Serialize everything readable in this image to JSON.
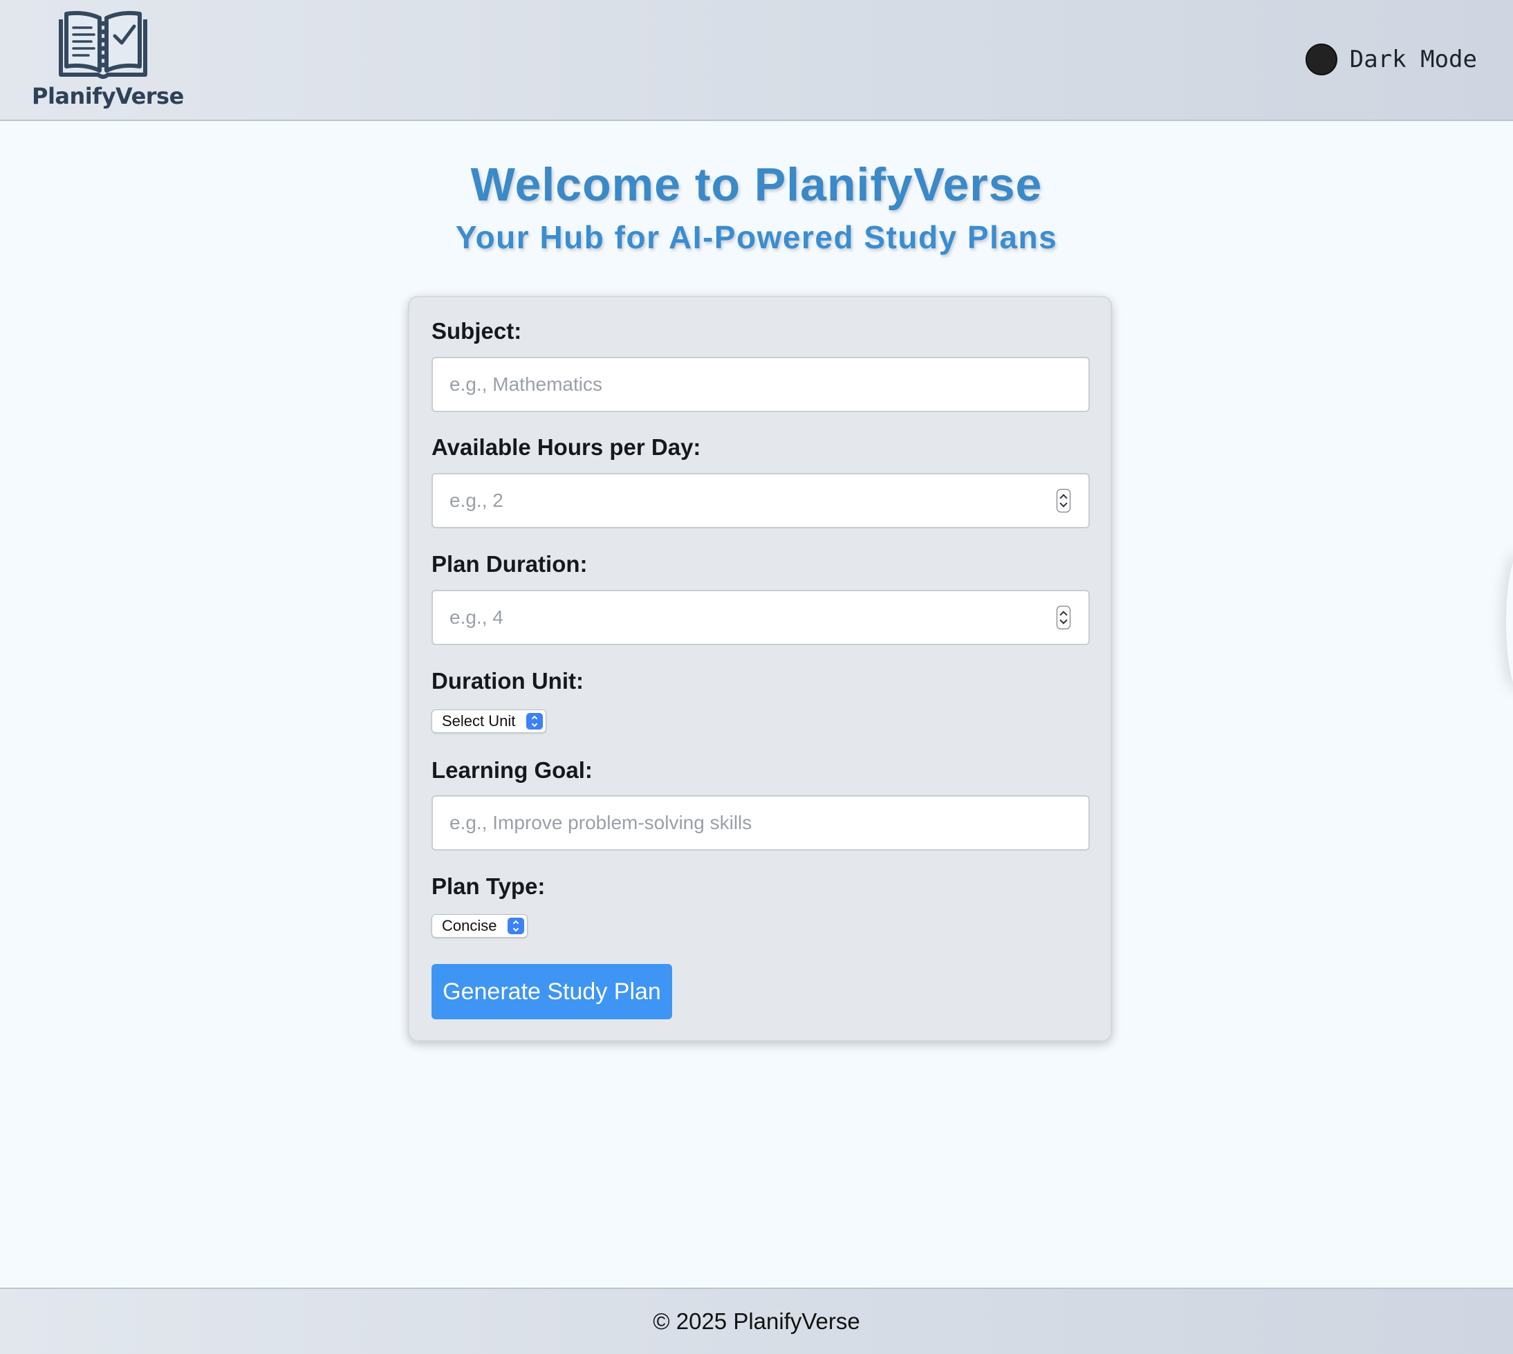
{
  "header": {
    "logo_text": "PlanifyVerse",
    "logo_icon": "open-book-checklist-icon",
    "dark_mode_label": "Dark Mode"
  },
  "hero": {
    "title": "Welcome to PlanifyVerse",
    "subtitle": "Your Hub for AI-Powered Study Plans"
  },
  "form": {
    "subject": {
      "label": "Subject:",
      "placeholder": "e.g., Mathematics",
      "value": ""
    },
    "hours": {
      "label": "Available Hours per Day:",
      "placeholder": "e.g., 2",
      "value": ""
    },
    "duration": {
      "label": "Plan Duration:",
      "placeholder": "e.g., 4",
      "value": ""
    },
    "duration_unit": {
      "label": "Duration Unit:",
      "selected": "Select Unit"
    },
    "goal": {
      "label": "Learning Goal:",
      "placeholder": "e.g., Improve problem-solving skills",
      "value": ""
    },
    "plan_type": {
      "label": "Plan Type:",
      "selected": "Concise"
    },
    "submit_label": "Generate Study Plan"
  },
  "footer": {
    "text": "© 2025 PlanifyVerse"
  },
  "colors": {
    "accent": "#3e95f3",
    "title": "#3a89c8",
    "card_bg": "#e4e8ed",
    "page_bg": "#f5faff"
  }
}
